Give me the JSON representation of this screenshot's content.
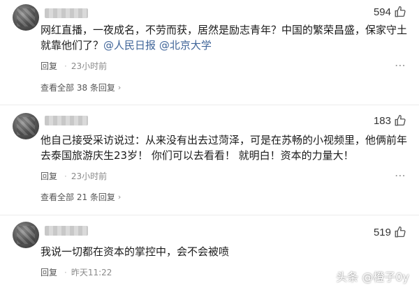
{
  "comments": [
    {
      "likes": "594",
      "text_parts": [
        "网红直播，一夜成名，不劳而获，居然是励志青年？中国的繁荣昌盛，保家守土就靠他们了？"
      ],
      "mentions": [
        "@人民日报",
        "@北京大学"
      ],
      "reply_label": "回复",
      "time": "23小时前",
      "view_replies": "查看全部 38 条回复"
    },
    {
      "likes": "183",
      "text": "他自己接受采访说过：从来没有出去过菏泽，可是在苏畅的小视频里，他俩前年去泰国旅游庆生23岁！  你们可以去看看！  就明白！资本的力量大！",
      "reply_label": "回复",
      "time": "23小时前",
      "view_replies": "查看全部 21 条回复"
    },
    {
      "likes": "519",
      "text": "我说一切都在资本的掌控中，会不会被喷",
      "reply_label": "回复",
      "time": "昨天11:22"
    }
  ],
  "watermark": "头条 @橙子0y",
  "colors": {
    "mention": "#406599",
    "meta": "#8a8a8a"
  },
  "icons": {
    "like": "thumbs-up-icon",
    "more": "more-icon"
  }
}
